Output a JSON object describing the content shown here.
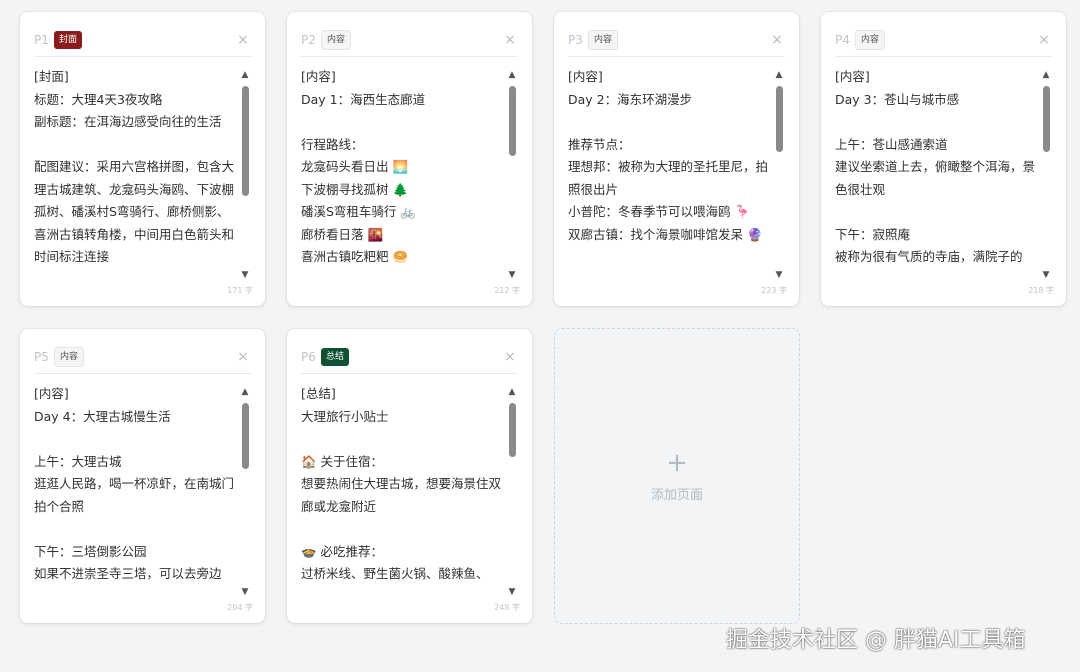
{
  "pages": [
    {
      "number": "P1",
      "badge": "封面",
      "text": "[封面]\n标题：大理4天3夜攻略\n副标题：在洱海边感受向往的生活\n\n配图建议：采用六宫格拼图，包含大理古城建筑、龙龛码头海鸥、下波棚孤树、磻溪村S弯骑行、廊桥侧影、喜洲古镇转角楼，中间用白色箭头和时间标注连接",
      "count": "171 字",
      "close": "×"
    },
    {
      "number": "P2",
      "badge": "内容",
      "text": "[内容]\nDay 1：海西生态廊道\n\n行程路线：\n龙龛码头看日出 🌅\n下波棚寻找孤树 🌲\n磻溪S弯租车骑行 🚲\n廊桥看日落 🌇\n喜洲古镇吃粑粑 🥯",
      "count": "212 字",
      "close": "×"
    },
    {
      "number": "P3",
      "badge": "内容",
      "text": "[内容]\nDay 2：海东环湖漫步\n\n推荐节点：\n理想邦：被称为大理的圣托里尼，拍照很出片\n小普陀：冬春季节可以喂海鸥 🦩\n双廊古镇：找个海景咖啡馆发呆 🔮",
      "count": "223 字",
      "close": "×"
    },
    {
      "number": "P4",
      "badge": "内容",
      "text": "[内容]\nDay 3：苍山与城市感\n\n上午：苍山感通索道\n建议坐索道上去，俯瞰整个洱海，景色很壮观\n\n下午：寂照庵\n被称为很有气质的寺庙，满院子的",
      "count": "218 字",
      "close": "×"
    },
    {
      "number": "P5",
      "badge": "内容",
      "text": "[内容]\nDay 4：大理古城慢生活\n\n上午：大理古城\n逛逛人民路，喝一杯凉虾，在南城门拍个合照\n\n下午：三塔倒影公园\n如果不进崇圣寺三塔，可以去旁边",
      "count": "204 字",
      "close": "×"
    },
    {
      "number": "P6",
      "badge": "总结",
      "text": "[总结]\n大理旅行小贴士\n\n🏠 关于住宿：\n想要热闹住大理古城，想要海景住双廊或龙龛附近\n\n🍲 必吃推荐：\n过桥米线、野生菌火锅、酸辣鱼、",
      "count": "248 字",
      "close": "×"
    }
  ],
  "add_page": {
    "plus": "+",
    "label": "添加页面"
  },
  "watermark": "掘金技术社区 @ 胖猫AI工具箱",
  "scroll": {
    "up": "▲",
    "down": "▼"
  }
}
